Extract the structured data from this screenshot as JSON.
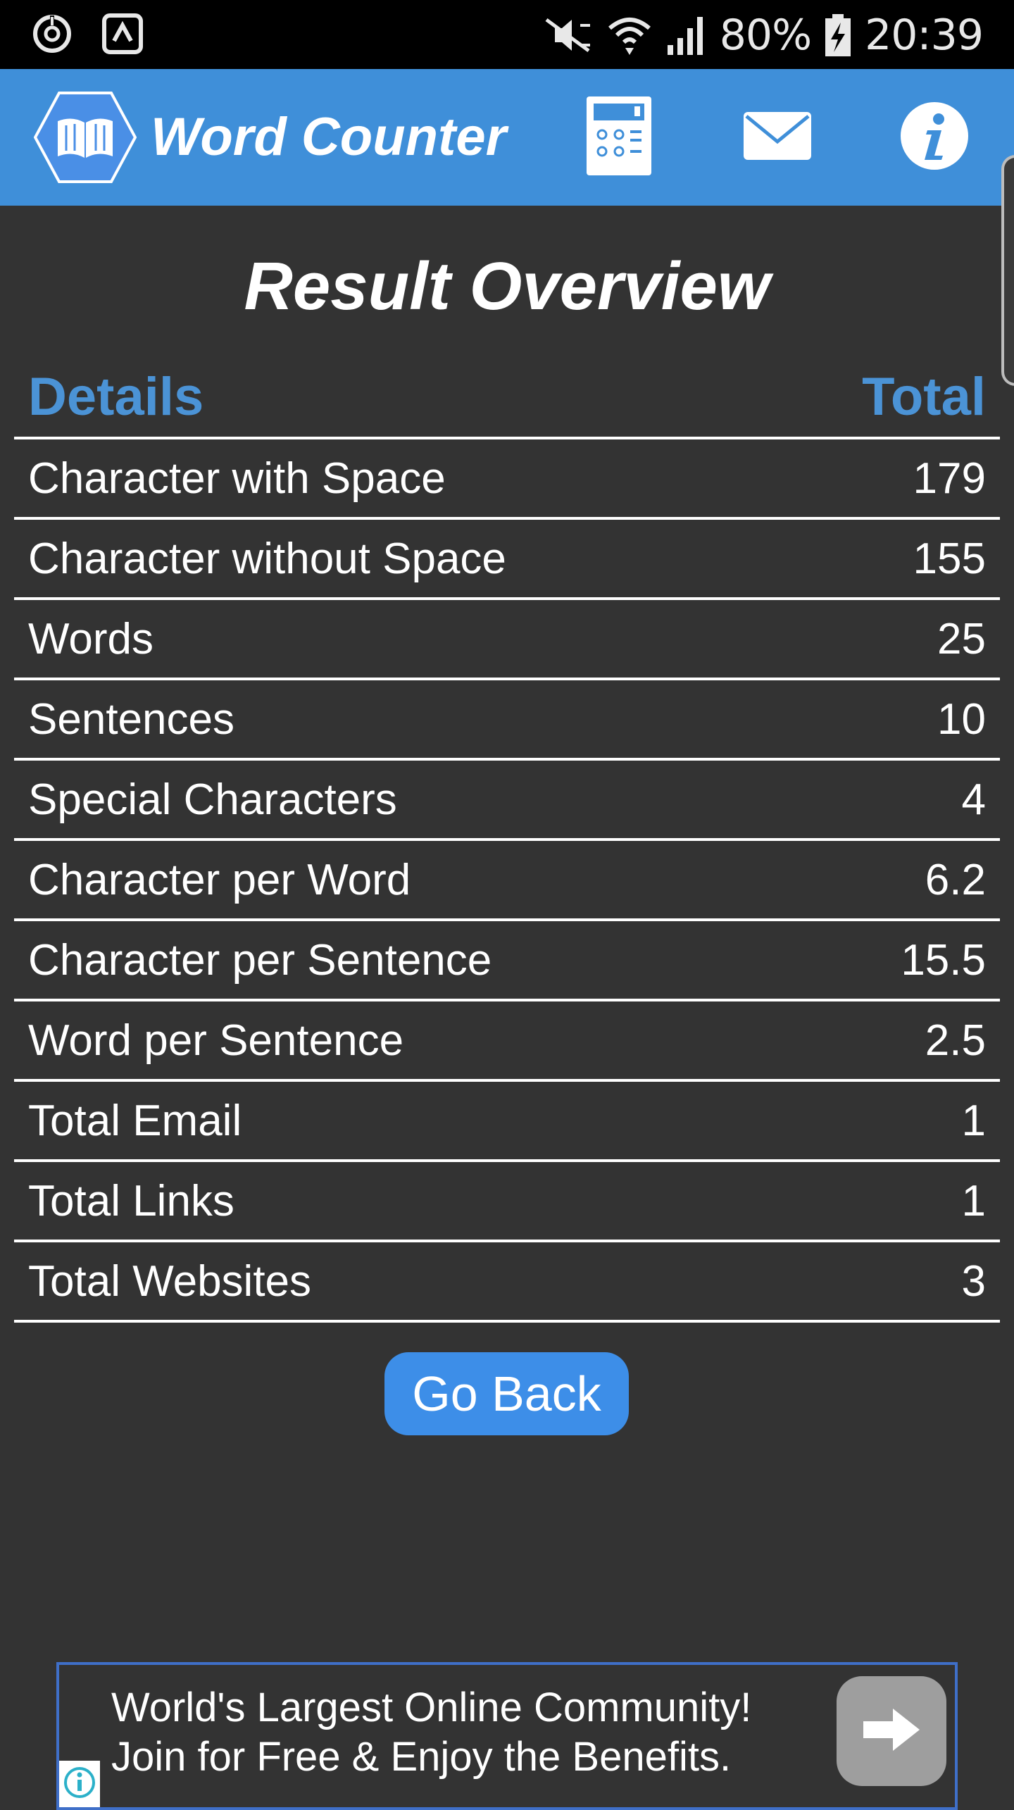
{
  "status_bar": {
    "battery": "80%",
    "time": "20:39"
  },
  "app_bar": {
    "title": "Word Counter",
    "icons": [
      "book-logo-icon",
      "calculator-icon",
      "mail-icon",
      "info-icon"
    ]
  },
  "page": {
    "title": "Result Overview"
  },
  "table": {
    "header_details": "Details",
    "header_total": "Total",
    "rows": [
      {
        "label": "Character with Space",
        "value": "179"
      },
      {
        "label": "Character without Space",
        "value": "155"
      },
      {
        "label": "Words",
        "value": "25"
      },
      {
        "label": "Sentences",
        "value": "10"
      },
      {
        "label": "Special Characters",
        "value": "4"
      },
      {
        "label": "Character per Word",
        "value": "6.2"
      },
      {
        "label": "Character per Sentence",
        "value": "15.5"
      },
      {
        "label": "Word per Sentence",
        "value": "2.5"
      },
      {
        "label": "Total Email",
        "value": "1"
      },
      {
        "label": "Total Links",
        "value": "1"
      },
      {
        "label": "Total Websites",
        "value": "3"
      }
    ]
  },
  "go_back_label": "Go Back",
  "ad": {
    "line1": "World's Largest Online Community!",
    "line2": "Join for Free & Enjoy the Benefits."
  },
  "colors": {
    "app_bar": "#3f8fd9",
    "background": "#333333",
    "header_text": "#4b93d6",
    "button": "#3d8ee8"
  }
}
